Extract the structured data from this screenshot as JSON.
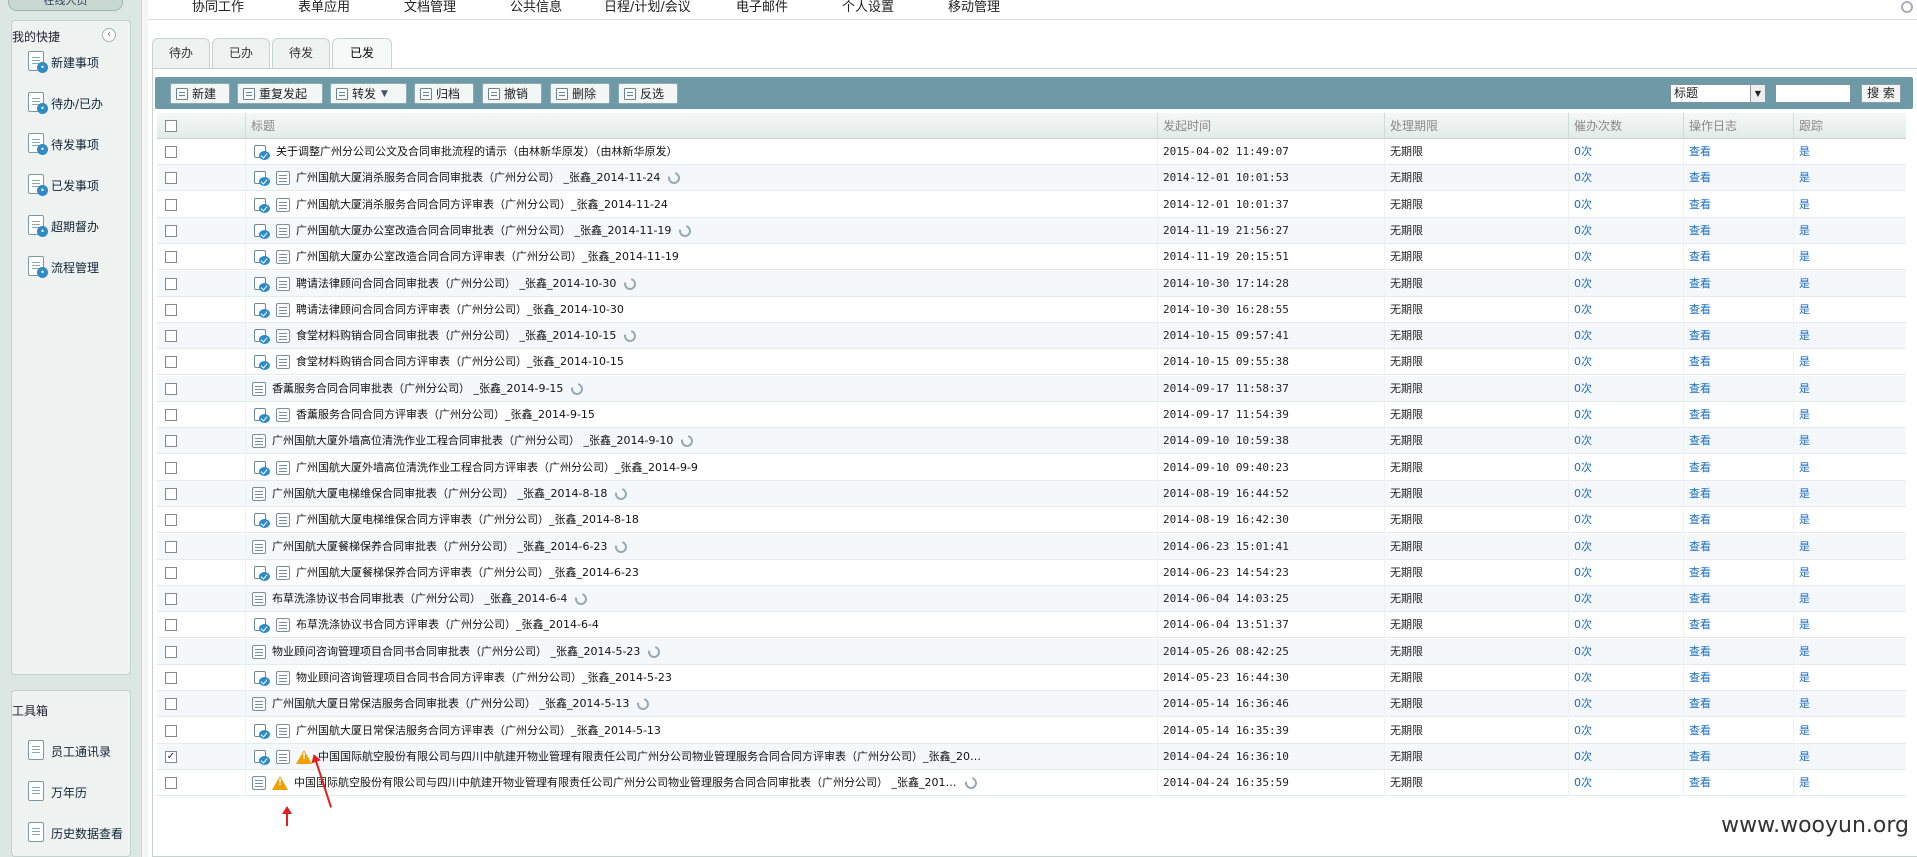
{
  "sidebar": {
    "top_button": "在线人员",
    "quick_title": "我的快捷",
    "quick_items": [
      "新建事项",
      "待办/已办",
      "待发事项",
      "已发事项",
      "超期督办",
      "流程管理"
    ],
    "tools_title": "工具箱",
    "tool_items": [
      "员工通讯录",
      "万年历",
      "历史数据查看"
    ]
  },
  "topnav": [
    "协同工作",
    "表单应用",
    "文档管理",
    "公共信息",
    "日程/计划/会议",
    "电子邮件",
    "个人设置",
    "移动管理"
  ],
  "tabs": [
    "待办",
    "已办",
    "待发",
    "已发"
  ],
  "active_tab": "已发",
  "toolbar": {
    "buttons": [
      "新建",
      "重复发起",
      "转发",
      "归档",
      "撤销",
      "删除",
      "反选"
    ],
    "search_select": "标题",
    "search_input": "",
    "search_button": "搜 索"
  },
  "table": {
    "headers": [
      "标题",
      "发起时间",
      "处理期限",
      "催办次数",
      "操作日志",
      "跟踪"
    ],
    "rows": [
      {
        "checked": false,
        "flow": true,
        "form": false,
        "warn": false,
        "clip": false,
        "title": "关于调整广州分公司公文及合同审批流程的请示（由林新华原发）（由林新华原发）",
        "time": "2015-04-02 11:49:07",
        "deadline": "无期限",
        "urge": "0次",
        "log": "查看",
        "track": "是"
      },
      {
        "checked": false,
        "flow": true,
        "form": true,
        "warn": false,
        "clip": true,
        "title": "广州国航大厦消杀服务合同合同审批表（广州分公司） _张鑫_2014-11-24",
        "time": "2014-12-01 10:01:53",
        "deadline": "无期限",
        "urge": "0次",
        "log": "查看",
        "track": "是"
      },
      {
        "checked": false,
        "flow": true,
        "form": true,
        "warn": false,
        "clip": false,
        "title": "广州国航大厦消杀服务合同合同方评审表（广州分公司）_张鑫_2014-11-24",
        "time": "2014-12-01 10:01:37",
        "deadline": "无期限",
        "urge": "0次",
        "log": "查看",
        "track": "是"
      },
      {
        "checked": false,
        "flow": true,
        "form": true,
        "warn": false,
        "clip": true,
        "title": "广州国航大厦办公室改造合同合同审批表（广州分公司） _张鑫_2014-11-19",
        "time": "2014-11-19 21:56:27",
        "deadline": "无期限",
        "urge": "0次",
        "log": "查看",
        "track": "是"
      },
      {
        "checked": false,
        "flow": true,
        "form": true,
        "warn": false,
        "clip": false,
        "title": "广州国航大厦办公室改造合同合同方评审表（广州分公司）_张鑫_2014-11-19",
        "time": "2014-11-19 20:15:51",
        "deadline": "无期限",
        "urge": "0次",
        "log": "查看",
        "track": "是"
      },
      {
        "checked": false,
        "flow": true,
        "form": true,
        "warn": false,
        "clip": true,
        "title": "聘请法律顾问合同合同审批表（广州分公司） _张鑫_2014-10-30",
        "time": "2014-10-30 17:14:28",
        "deadline": "无期限",
        "urge": "0次",
        "log": "查看",
        "track": "是"
      },
      {
        "checked": false,
        "flow": true,
        "form": true,
        "warn": false,
        "clip": false,
        "title": "聘请法律顾问合同合同方评审表（广州分公司）_张鑫_2014-10-30",
        "time": "2014-10-30 16:28:55",
        "deadline": "无期限",
        "urge": "0次",
        "log": "查看",
        "track": "是"
      },
      {
        "checked": false,
        "flow": true,
        "form": true,
        "warn": false,
        "clip": true,
        "title": "食堂材料购销合同合同审批表（广州分公司） _张鑫_2014-10-15",
        "time": "2014-10-15 09:57:41",
        "deadline": "无期限",
        "urge": "0次",
        "log": "查看",
        "track": "是"
      },
      {
        "checked": false,
        "flow": true,
        "form": true,
        "warn": false,
        "clip": false,
        "title": "食堂材料购销合同合同方评审表（广州分公司）_张鑫_2014-10-15",
        "time": "2014-10-15 09:55:38",
        "deadline": "无期限",
        "urge": "0次",
        "log": "查看",
        "track": "是"
      },
      {
        "checked": false,
        "flow": false,
        "form": true,
        "warn": false,
        "clip": true,
        "title": "香薰服务合同合同审批表（广州分公司） _张鑫_2014-9-15",
        "time": "2014-09-17 11:58:37",
        "deadline": "无期限",
        "urge": "0次",
        "log": "查看",
        "track": "是"
      },
      {
        "checked": false,
        "flow": true,
        "form": true,
        "warn": false,
        "clip": false,
        "title": "香薰服务合同合同方评审表（广州分公司）_张鑫_2014-9-15",
        "time": "2014-09-17 11:54:39",
        "deadline": "无期限",
        "urge": "0次",
        "log": "查看",
        "track": "是"
      },
      {
        "checked": false,
        "flow": false,
        "form": true,
        "warn": false,
        "clip": true,
        "title": "广州国航大厦外墙高位清洗作业工程合同审批表（广州分公司） _张鑫_2014-9-10",
        "time": "2014-09-10 10:59:38",
        "deadline": "无期限",
        "urge": "0次",
        "log": "查看",
        "track": "是"
      },
      {
        "checked": false,
        "flow": true,
        "form": true,
        "warn": false,
        "clip": false,
        "title": "广州国航大厦外墙高位清洗作业工程合同方评审表（广州分公司）_张鑫_2014-9-9",
        "time": "2014-09-10 09:40:23",
        "deadline": "无期限",
        "urge": "0次",
        "log": "查看",
        "track": "是"
      },
      {
        "checked": false,
        "flow": false,
        "form": true,
        "warn": false,
        "clip": true,
        "title": "广州国航大厦电梯维保合同审批表（广州分公司） _张鑫_2014-8-18",
        "time": "2014-08-19 16:44:52",
        "deadline": "无期限",
        "urge": "0次",
        "log": "查看",
        "track": "是"
      },
      {
        "checked": false,
        "flow": true,
        "form": true,
        "warn": false,
        "clip": false,
        "title": "广州国航大厦电梯维保合同方评审表（广州分公司）_张鑫_2014-8-18",
        "time": "2014-08-19 16:42:30",
        "deadline": "无期限",
        "urge": "0次",
        "log": "查看",
        "track": "是"
      },
      {
        "checked": false,
        "flow": false,
        "form": true,
        "warn": false,
        "clip": true,
        "title": "广州国航大厦餐梯保养合同审批表（广州分公司） _张鑫_2014-6-23",
        "time": "2014-06-23 15:01:41",
        "deadline": "无期限",
        "urge": "0次",
        "log": "查看",
        "track": "是"
      },
      {
        "checked": false,
        "flow": true,
        "form": true,
        "warn": false,
        "clip": false,
        "title": "广州国航大厦餐梯保养合同方评审表（广州分公司）_张鑫_2014-6-23",
        "time": "2014-06-23 14:54:23",
        "deadline": "无期限",
        "urge": "0次",
        "log": "查看",
        "track": "是"
      },
      {
        "checked": false,
        "flow": false,
        "form": true,
        "warn": false,
        "clip": true,
        "title": "布草洗涤协议书合同审批表（广州分公司） _张鑫_2014-6-4",
        "time": "2014-06-04 14:03:25",
        "deadline": "无期限",
        "urge": "0次",
        "log": "查看",
        "track": "是"
      },
      {
        "checked": false,
        "flow": true,
        "form": true,
        "warn": false,
        "clip": false,
        "title": "布草洗涤协议书合同方评审表（广州分公司）_张鑫_2014-6-4",
        "time": "2014-06-04 13:51:37",
        "deadline": "无期限",
        "urge": "0次",
        "log": "查看",
        "track": "是"
      },
      {
        "checked": false,
        "flow": false,
        "form": true,
        "warn": false,
        "clip": true,
        "title": "物业顾问咨询管理项目合同书合同审批表（广州分公司） _张鑫_2014-5-23",
        "time": "2014-05-26 08:42:25",
        "deadline": "无期限",
        "urge": "0次",
        "log": "查看",
        "track": "是"
      },
      {
        "checked": false,
        "flow": true,
        "form": true,
        "warn": false,
        "clip": false,
        "title": "物业顾问咨询管理项目合同书合同方评审表（广州分公司）_张鑫_2014-5-23",
        "time": "2014-05-23 16:44:30",
        "deadline": "无期限",
        "urge": "0次",
        "log": "查看",
        "track": "是"
      },
      {
        "checked": false,
        "flow": false,
        "form": true,
        "warn": false,
        "clip": true,
        "title": "广州国航大厦日常保洁服务合同审批表（广州分公司） _张鑫_2014-5-13",
        "time": "2014-05-14 16:36:46",
        "deadline": "无期限",
        "urge": "0次",
        "log": "查看",
        "track": "是"
      },
      {
        "checked": false,
        "flow": true,
        "form": true,
        "warn": false,
        "clip": false,
        "title": "广州国航大厦日常保洁服务合同方评审表（广州分公司）_张鑫_2014-5-13",
        "time": "2014-05-14 16:35:39",
        "deadline": "无期限",
        "urge": "0次",
        "log": "查看",
        "track": "是"
      },
      {
        "checked": true,
        "flow": true,
        "form": true,
        "warn": true,
        "clip": false,
        "title": "中国国际航空股份有限公司与四川中航建开物业管理有限责任公司广州分公司物业管理服务合同合同方评审表（广州分公司）_张鑫_20…",
        "time": "2014-04-24 16:36:10",
        "deadline": "无期限",
        "urge": "0次",
        "log": "查看",
        "track": "是"
      },
      {
        "checked": false,
        "flow": false,
        "form": true,
        "warn": true,
        "clip": true,
        "title": "中国国际航空股份有限公司与四川中航建开物业管理有限责任公司广州分公司物业管理服务合同合同审批表（广州分公司） _张鑫_201…",
        "time": "2014-04-24 16:35:59",
        "deadline": "无期限",
        "urge": "0次",
        "log": "查看",
        "track": "是"
      }
    ]
  },
  "watermark": "www.wooyun.org",
  "colors": {
    "toolbar": "#6e9aa8",
    "link": "#1a6cc0",
    "warning": "#f0a000",
    "annotation": "#e02020"
  }
}
